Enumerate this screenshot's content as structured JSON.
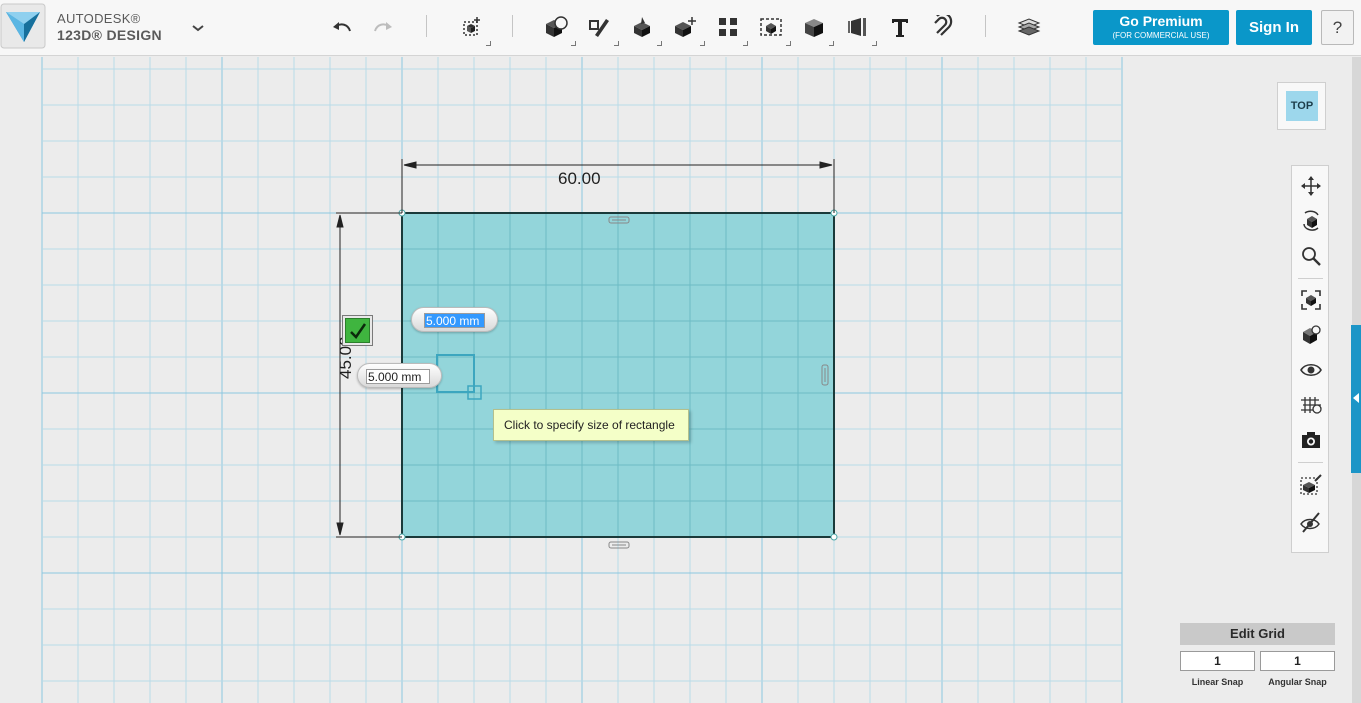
{
  "app": {
    "brand_line1": "AUTODESK®",
    "brand_line2": "123D® DESIGN",
    "logo_icon": "123d-design-logo-icon",
    "menu_icon": "chevron-down-icon"
  },
  "toolbar": {
    "undo_icon": "undo-icon",
    "redo_icon": "redo-icon",
    "tools": [
      {
        "name": "transform",
        "icon": "transform-icon"
      },
      {
        "name": "primitives",
        "icon": "primitives-icon"
      },
      {
        "name": "sketch",
        "icon": "sketch-icon"
      },
      {
        "name": "construct",
        "icon": "construct-icon"
      },
      {
        "name": "modify",
        "icon": "modify-icon"
      },
      {
        "name": "pattern",
        "icon": "pattern-icon"
      },
      {
        "name": "grouping",
        "icon": "grouping-icon"
      },
      {
        "name": "combine",
        "icon": "combine-icon"
      },
      {
        "name": "measure",
        "icon": "measure-icon"
      },
      {
        "name": "text",
        "icon": "text-icon"
      },
      {
        "name": "snap",
        "icon": "snap-magnet-icon"
      },
      {
        "name": "material",
        "icon": "material-layers-icon"
      }
    ],
    "premium_label": "Go Premium",
    "premium_sublabel": "(FOR COMMERCIAL USE)",
    "signin_label": "Sign In",
    "help_label": "?"
  },
  "canvas": {
    "width_dimension": "60.00",
    "height_dimension": "45.00",
    "width_input_value": "5.000 mm",
    "height_input_value": "5.000 mm",
    "hint_text": "Click to specify size of rectangle",
    "confirm_icon": "checkmark-icon",
    "colors": {
      "background": "#ececec",
      "grid_minor": "#b9dbe8",
      "grid_major": "#8cc7e0",
      "sketch_fill": "#7fcfd6",
      "sketch_edge": "#1a3a3a",
      "accent": "#0a97c9"
    }
  },
  "view_cube": {
    "face_label": "TOP"
  },
  "navigation": {
    "items": [
      {
        "name": "pan",
        "icon": "pan-icon"
      },
      {
        "name": "orbit",
        "icon": "orbit-icon"
      },
      {
        "name": "zoom",
        "icon": "zoom-icon"
      },
      {
        "name": "fit",
        "icon": "fit-icon"
      },
      {
        "name": "views",
        "icon": "view-cube-icon"
      },
      {
        "name": "visibility",
        "icon": "eye-icon"
      },
      {
        "name": "grid-display",
        "icon": "grid-icon"
      },
      {
        "name": "screenshot",
        "icon": "camera-icon"
      },
      {
        "name": "material-tools",
        "icon": "material-icon"
      },
      {
        "name": "hide-show",
        "icon": "hide-icon"
      }
    ]
  },
  "grid_panel": {
    "edit_label": "Edit Grid",
    "linear_snap_value": "1",
    "angular_snap_value": "1",
    "linear_label": "Linear Snap",
    "angular_label": "Angular Snap"
  }
}
